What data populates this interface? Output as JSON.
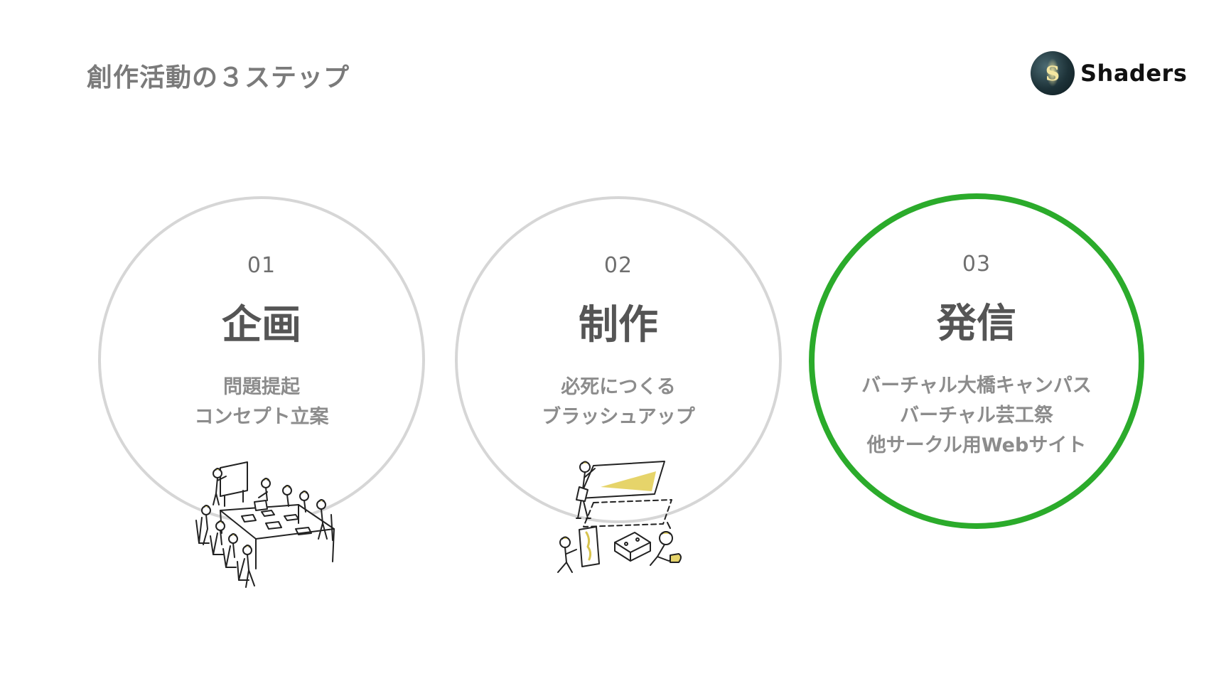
{
  "slide": {
    "title": "創作活動の３ステップ",
    "logo_text": "Shaders",
    "logo_glyph": "S",
    "accent_color": "#2bab2b",
    "muted_circle_color": "#d6d6d6"
  },
  "steps": [
    {
      "number": "01",
      "title": "企画",
      "lines": [
        "問題提起",
        "コンセプト立案"
      ],
      "illustration": "meeting-illustration"
    },
    {
      "number": "02",
      "title": "制作",
      "lines": [
        "必死につくる",
        "ブラッシュアップ"
      ],
      "illustration": "building-illustration"
    },
    {
      "number": "03",
      "title": "発信",
      "lines": [
        "バーチャル大橋キャンパス",
        "バーチャル芸工祭",
        "他サークル用Webサイト"
      ],
      "highlighted": true
    }
  ]
}
